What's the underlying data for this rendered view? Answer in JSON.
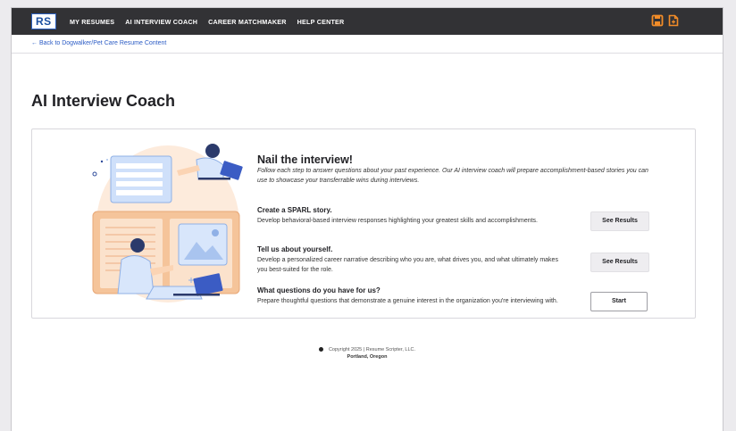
{
  "nav": {
    "logo": "RS",
    "links": [
      "MY RESUMES",
      "AI INTERVIEW COACH",
      "CAREER MATCHMAKER",
      "HELP CENTER"
    ],
    "icons": [
      "save-icon",
      "document-icon"
    ],
    "accent_color": "#f28c28",
    "bar_color": "#323235"
  },
  "back_link": "← Back to Dogwalker/Pet Care Resume Content",
  "page_title": "AI Interview Coach",
  "card": {
    "heading": "Nail the interview!",
    "intro": "Follow each step to answer questions about your past experience. Our AI interview coach will prepare accomplishment-based stories you can use to showcase your transferrable wins during interviews.",
    "steps": [
      {
        "title": "Create a SPARL story.",
        "desc": "Develop behavioral-based interview responses highlighting your greatest skills and accomplishments.",
        "button": "See Results"
      },
      {
        "title": "Tell us about yourself.",
        "desc": "Develop a personalized career narrative describing who you are, what drives you, and what ultimately makes you best-suited for the role.",
        "button": "See Results"
      },
      {
        "title": "What questions do you have for us?",
        "desc": "Prepare thoughtful questions that demonstrate a genuine interest in the organization you're interviewing with.",
        "button": "Start"
      }
    ]
  },
  "footer": {
    "copyright": "Copyright 2025 | Resume Scripter, LLC.",
    "location": "Portland, Oregon"
  }
}
